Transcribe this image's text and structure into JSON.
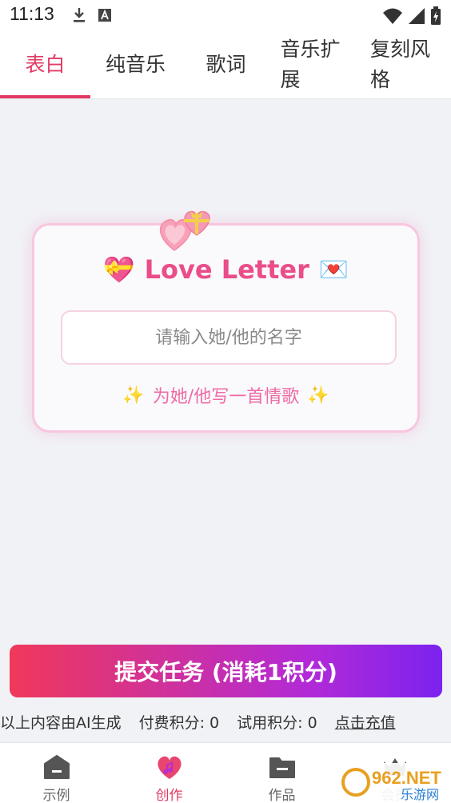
{
  "status_bar": {
    "time": "11:13",
    "icons_left": [
      "download-icon",
      "a-badge-icon"
    ],
    "icons_right": [
      "wifi-icon",
      "signal-icon",
      "battery-icon"
    ]
  },
  "tabs": [
    {
      "label": "表白",
      "active": true
    },
    {
      "label": "纯音乐",
      "active": false
    },
    {
      "label": "歌词",
      "active": false
    },
    {
      "label": "音乐扩展",
      "active": false
    },
    {
      "label": "复刻风格",
      "active": false
    }
  ],
  "card": {
    "title_emoji_left": "💝",
    "title": "Love Letter",
    "title_emoji_right": "💌",
    "hearts_emoji": "💗💝",
    "input_placeholder": "请输入她/他的名字",
    "subtitle": "为她/他写一首情歌",
    "sparkle": "✨"
  },
  "submit": {
    "label": "提交任务 (消耗1积分)"
  },
  "info": {
    "ai_notice": "以上内容由AI生成",
    "paid_points": "付费积分: 0",
    "trial_points": "试用积分: 0",
    "recharge": "点击充值"
  },
  "bottom_nav": [
    {
      "label": "示例",
      "icon": "home-icon",
      "active": false
    },
    {
      "label": "创作",
      "icon": "heart-icon",
      "active": true
    },
    {
      "label": "作品",
      "icon": "folder-icon",
      "active": false
    },
    {
      "label": "会员",
      "icon": "crown-icon",
      "active": false
    }
  ],
  "watermark": {
    "line1": "962.NET",
    "line2": "乐游网"
  },
  "colors": {
    "accent": "#e23a64",
    "title_pink": "#ea4d8a",
    "card_border": "#f8c6df",
    "button_gradient_start": "#f0385a",
    "button_gradient_end": "#7c22ef"
  }
}
